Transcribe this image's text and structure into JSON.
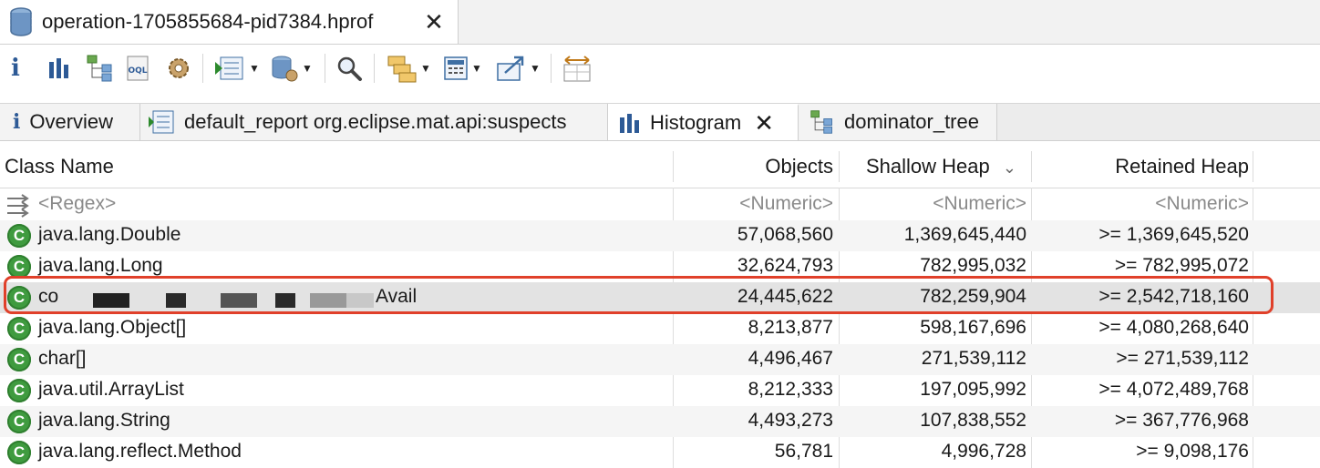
{
  "editor_tab": {
    "title": "operation-1705855684-pid7384.hprof",
    "close": "✕"
  },
  "toolbar": {
    "info_glyph": "i",
    "items": [
      "info-icon",
      "histogram-icon",
      "dominator-tree-icon",
      "oql-icon",
      "heap-dump-overview-icon",
      "run-expert-system-icon",
      "open-query-browser-icon",
      "search-icon",
      "group-result-icon",
      "calculate-retained-size-icon",
      "export-icon",
      "pin-icon"
    ]
  },
  "view_tabs": [
    {
      "label": "Overview",
      "glyph": "i"
    },
    {
      "label": "default_report org.eclipse.mat.api:suspects"
    },
    {
      "label": "Histogram",
      "close": "✕"
    },
    {
      "label": "dominator_tree"
    }
  ],
  "table": {
    "columns": {
      "name": "Class Name",
      "objects": "Objects",
      "shallow": "Shallow Heap",
      "retained": "Retained Heap",
      "sort_indicator": "⌄"
    },
    "filter_row": {
      "name": "<Regex>",
      "objects": "<Numeric>",
      "shallow": "<Numeric>",
      "retained": "<Numeric>"
    },
    "class_glyph": "C",
    "rows": [
      {
        "name": "java.lang.Double",
        "objects": "57,068,560",
        "shallow": "1,369,645,440",
        "retained": ">= 1,369,645,520"
      },
      {
        "name": "java.lang.Long",
        "objects": "32,624,793",
        "shallow": "782,995,032",
        "retained": ">= 782,995,072"
      },
      {
        "name_prefix": "co",
        "name_suffix": "Avail",
        "objects": "24,445,622",
        "shallow": "782,259,904",
        "retained": ">= 2,542,718,160"
      },
      {
        "name": "java.lang.Object[]",
        "objects": "8,213,877",
        "shallow": "598,167,696",
        "retained": ">= 4,080,268,640"
      },
      {
        "name": "char[]",
        "objects": "4,496,467",
        "shallow": "271,539,112",
        "retained": ">= 271,539,112"
      },
      {
        "name": "java.util.ArrayList",
        "objects": "8,212,333",
        "shallow": "197,095,992",
        "retained": ">= 4,072,489,768"
      },
      {
        "name": "java.lang.String",
        "objects": "4,493,273",
        "shallow": "107,838,552",
        "retained": ">= 367,776,968"
      },
      {
        "name": "java.lang.reflect.Method",
        "objects": "56,781",
        "shallow": "4,996,728",
        "retained": ">= 9,098,176"
      }
    ]
  },
  "colors": {
    "highlight": "#e0402a",
    "class_icon": "#3f9b3f"
  }
}
